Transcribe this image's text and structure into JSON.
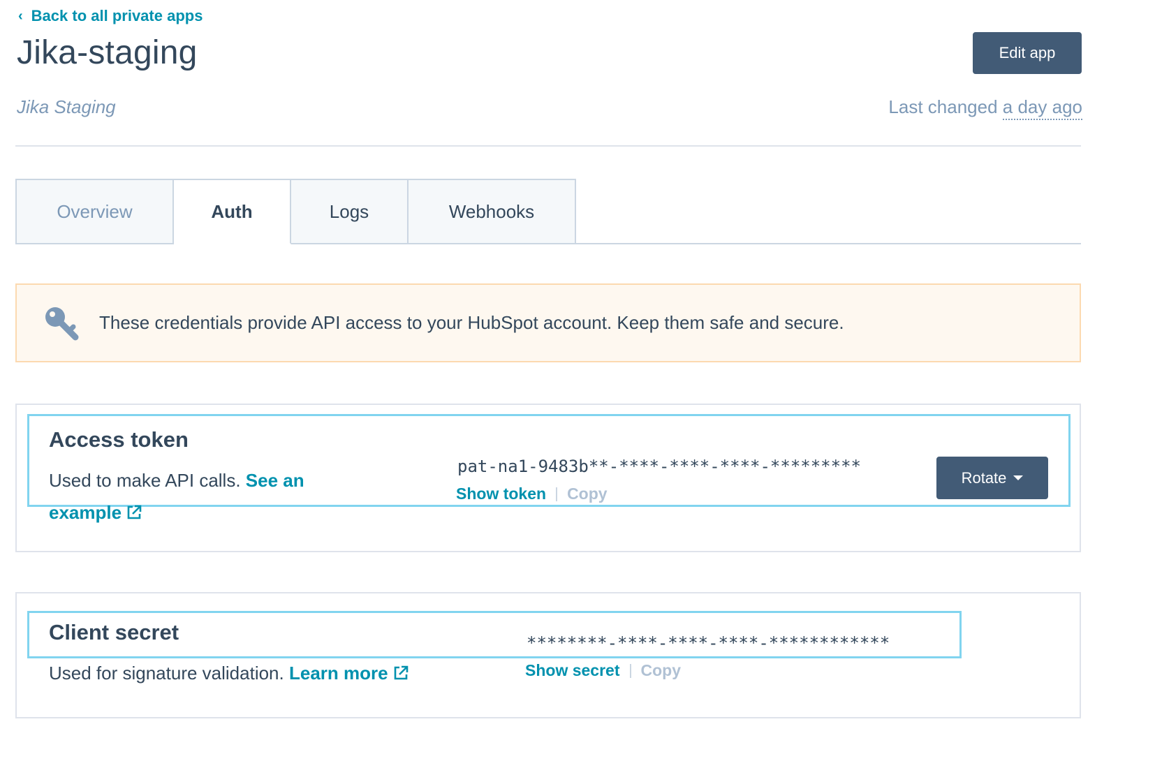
{
  "header": {
    "back_link": "Back to all private apps",
    "app_name": "Jika-staging",
    "edit_button": "Edit app",
    "subtitle": "Jika Staging",
    "last_changed_prefix": "Last changed",
    "last_changed_relative": "a day ago"
  },
  "tabs": [
    {
      "label": "Overview",
      "active": false
    },
    {
      "label": "Auth",
      "active": true
    },
    {
      "label": "Logs",
      "active": false
    },
    {
      "label": "Webhooks",
      "active": false
    }
  ],
  "alert": {
    "icon": "key-icon",
    "message": "These credentials provide API access to your HubSpot account. Keep them safe and secure."
  },
  "access_token": {
    "title": "Access token",
    "description": "Used to make API calls.",
    "link": "See an example",
    "link_first": "See an",
    "link_second": "example",
    "value": "pat-na1-9483b**-****-****-****-*********",
    "show_label": "Show token",
    "copy_label": "Copy",
    "rotate_button": "Rotate"
  },
  "client_secret": {
    "title": "Client secret",
    "description": "Used for signature validation.",
    "link": "Learn more",
    "value": "********-****-****-****-************",
    "show_label": "Show secret",
    "copy_label": "Copy"
  },
  "colors": {
    "accent": "#0091ae",
    "primary_button": "#425b76",
    "text": "#33475b",
    "muted": "#7c98b6",
    "alert_bg": "#fef8f0",
    "alert_border": "#fcd9b0",
    "highlight": "#81d4ef"
  }
}
